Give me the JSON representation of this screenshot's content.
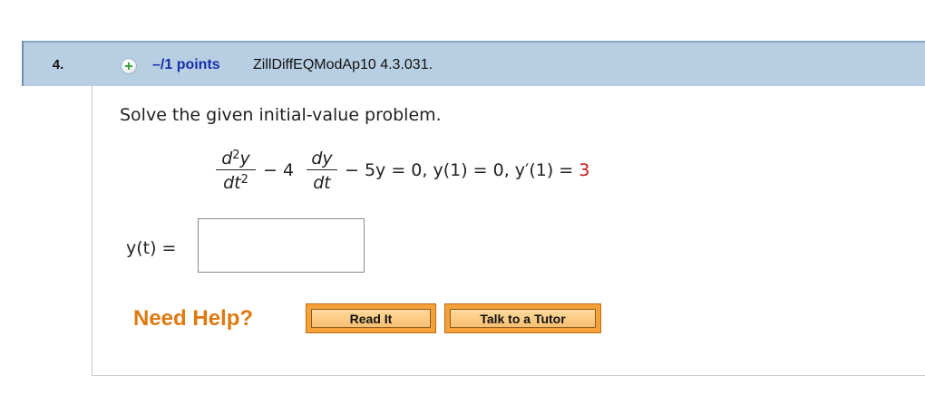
{
  "question": {
    "number": "4.",
    "points": "–/1 points",
    "id": "ZillDiffEQModAp10 4.3.031.",
    "prompt": "Solve the given initial-value problem.",
    "equation": {
      "frac1_num": "d",
      "frac1_num_sup": "2",
      "frac1_num_var": "y",
      "frac1_den": "dt",
      "frac1_den_sup": "2",
      "minus1": "−  4",
      "frac2_num": "dy",
      "frac2_den": "dt",
      "rest": "−  5y  =  0,   y(1)  =  0,  y′(1)  =  ",
      "initial_value": "3"
    },
    "answer_label": "y(t)  =",
    "answer_value": ""
  },
  "help": {
    "label": "Need Help?",
    "read_it": "Read It",
    "talk_tutor": "Talk to a Tutor"
  }
}
